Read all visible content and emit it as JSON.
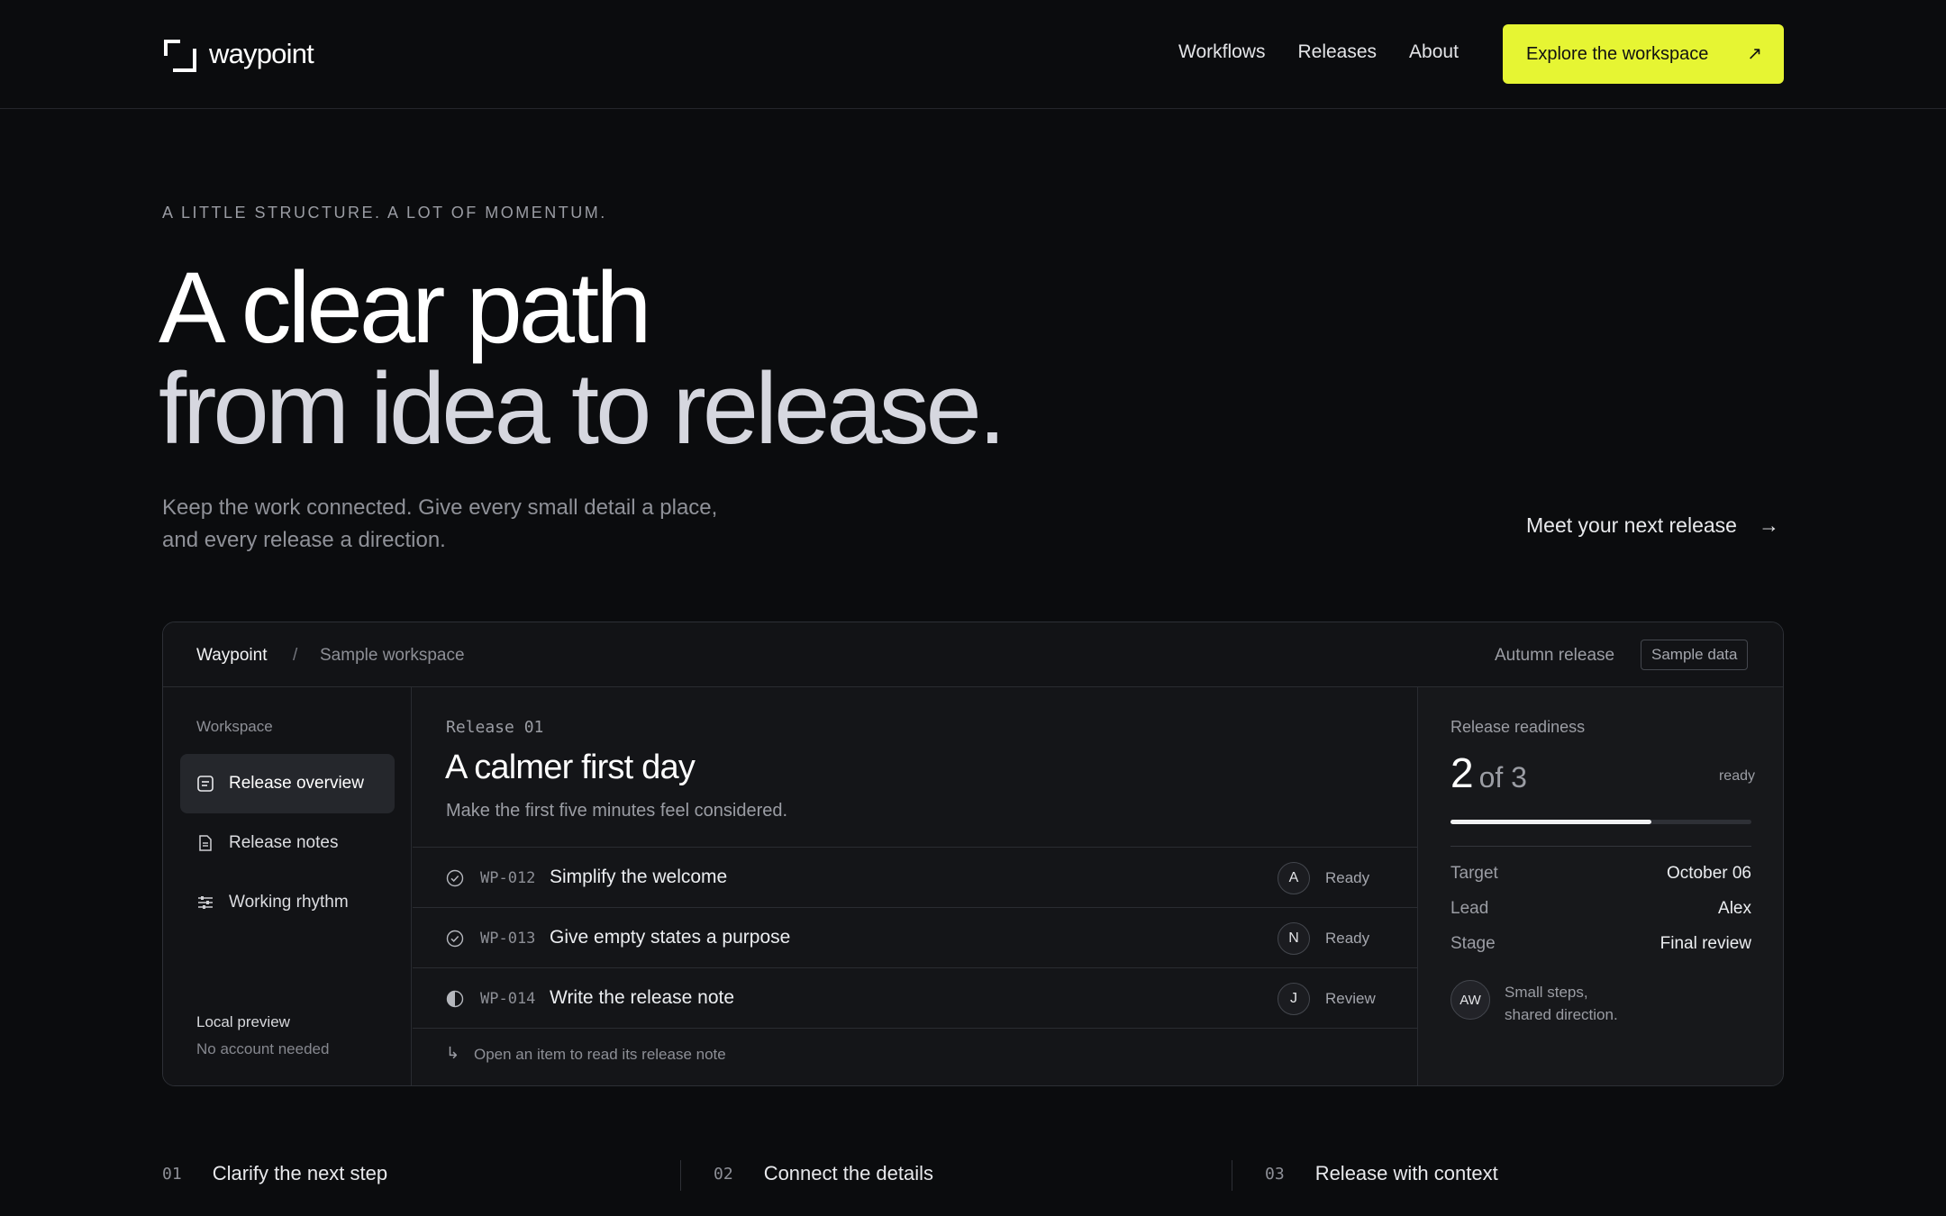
{
  "brand": {
    "name": "waypoint"
  },
  "nav": {
    "items": [
      "Workflows",
      "Releases",
      "About"
    ]
  },
  "cta": {
    "label": "Explore the workspace",
    "icon": "arrow-up-right-icon",
    "color": "#e6f533"
  },
  "hero": {
    "eyebrow": "A LITTLE STRUCTURE. A LOT OF MOMENTUM.",
    "title_line1": "A clear path",
    "title_line2": "from idea to release.",
    "lede_line1": "Keep the work connected. Give every small detail a place,",
    "lede_line2": "and every release a direction.",
    "meet_link": "Meet your next release"
  },
  "panel": {
    "breadcrumb": {
      "root": "Waypoint",
      "sep": "/",
      "current": "Sample workspace"
    },
    "release_label": "Autumn release",
    "badge": "Sample data",
    "sidebar": {
      "title": "Workspace",
      "items": [
        {
          "label": "Release overview",
          "icon": "overview-icon",
          "active": true
        },
        {
          "label": "Release notes",
          "icon": "document-icon",
          "active": false
        },
        {
          "label": "Working rhythm",
          "icon": "sliders-icon",
          "active": false
        }
      ],
      "footer_title": "Local preview",
      "footer_sub": "No account needed"
    },
    "main": {
      "release_number": "Release 01",
      "title": "A calmer first day",
      "subtitle": "Make the first five minutes feel considered.",
      "items": [
        {
          "code": "WP-012",
          "title": "Simplify the welcome",
          "assignee": "A",
          "status": "Ready",
          "status_icon": "check-circle-icon"
        },
        {
          "code": "WP-013",
          "title": "Give empty states a purpose",
          "assignee": "N",
          "status": "Ready",
          "status_icon": "check-circle-icon"
        },
        {
          "code": "WP-014",
          "title": "Write the release note",
          "assignee": "J",
          "status": "Review",
          "status_icon": "half-circle-icon"
        }
      ],
      "footer_hint": "Open an item to read its release note",
      "footer_icon": "return-arrow-icon"
    },
    "readiness": {
      "title": "Release readiness",
      "count": "2",
      "of": "of 3",
      "state": "ready",
      "progress": 0.667,
      "details": [
        {
          "key": "Target",
          "value": "October 06"
        },
        {
          "key": "Lead",
          "value": "Alex"
        },
        {
          "key": "Stage",
          "value": "Final review"
        }
      ],
      "avatar": "AW",
      "note_line1": "Small steps,",
      "note_line2": "shared direction."
    }
  },
  "steps": [
    {
      "num": "01",
      "label": "Clarify the next step"
    },
    {
      "num": "02",
      "label": "Connect the details"
    },
    {
      "num": "03",
      "label": "Release with context"
    }
  ]
}
